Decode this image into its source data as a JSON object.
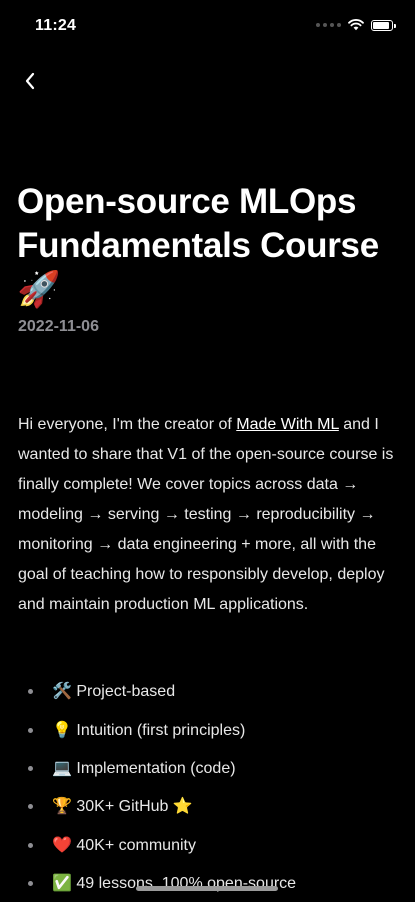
{
  "status_bar": {
    "time": "11:24"
  },
  "nav": {
    "back_icon": "chevron-left-icon"
  },
  "post": {
    "title": "Open-source MLOps Fundamentals Course 🚀",
    "date": "2022-11-06",
    "intro_before_link": "Hi everyone, I'm the creator of ",
    "link_text": "Made With ML",
    "intro_after_link": " and I wanted to share that V1 of the open-source course is finally complete! We cover topics across data → modeling → serving → testing → reproducibility → monitoring → data engineering + more, all with the goal of teaching how to responsibly develop, deploy and maintain production ML applications.",
    "bullets": [
      "🛠️ Project-based",
      "💡 Intuition (first principles)",
      "💻 Implementation (code)",
      "🏆 30K+ GitHub ⭐️",
      "❤️ 40K+ community",
      "✅ 49 lessons, 100% open-source"
    ]
  },
  "colors": {
    "background": "#000000",
    "text": "#e8e8e8",
    "muted": "#8e8e93"
  }
}
